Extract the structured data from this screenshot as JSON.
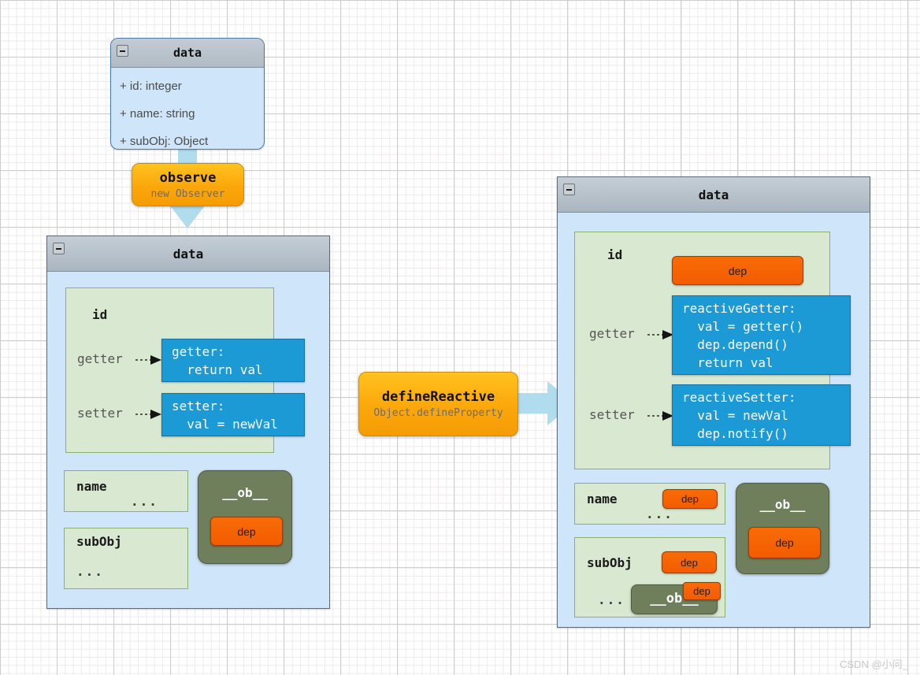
{
  "diagram": {
    "title_bar_icon": "collapse-icon",
    "watermark": "CSDN @小问_"
  },
  "uml_class": {
    "title": "data",
    "attributes": [
      "+ id: integer",
      "+ name: string",
      "+ subObj: Object"
    ]
  },
  "observe_pill": {
    "title": "observe",
    "subtitle": "new Observer"
  },
  "define_reactive_pill": {
    "title": "defineReactive",
    "subtitle": "Object.defineProperty"
  },
  "left_panel": {
    "title": "data",
    "id_block": {
      "name": "id",
      "getter_label": "getter",
      "setter_label": "setter",
      "getter_code": "getter:\n  return val",
      "setter_code": "setter:\n  val = newVal"
    },
    "name_block": {
      "name": "name",
      "ellipsis": "..."
    },
    "subobj_block": {
      "name": "subObj",
      "ellipsis": "..."
    },
    "observer_block": {
      "label": "__ob__",
      "dep": "dep"
    }
  },
  "right_panel": {
    "title": "data",
    "id_block": {
      "name": "id",
      "dep": "dep",
      "getter_label": "getter",
      "setter_label": "setter",
      "getter_code": "reactiveGetter:\n  val = getter()\n  dep.depend()\n  return val",
      "setter_code": "reactiveSetter:\n  val = newVal\n  dep.notify()"
    },
    "name_block": {
      "name": "name",
      "dep": "dep",
      "ellipsis": "..."
    },
    "subobj_block": {
      "name": "subObj",
      "dep": "dep",
      "ellipsis": "...",
      "nested_observer": {
        "label": "__ob__",
        "dep": "dep"
      }
    },
    "observer_block": {
      "label": "__ob__",
      "dep": "dep"
    }
  },
  "colors": {
    "panel_fill": "#cfe5f9",
    "panel_header": "#b0bbc4",
    "green_fill": "#d9e8d0",
    "green_border": "#8ab06c",
    "code_blue": "#1b9ad6",
    "dep_orange": "#f25c00",
    "observer_olive": "#6f7f5c",
    "pill_yellow": "#fba70a",
    "arrow_blue": "#b0dcee"
  }
}
